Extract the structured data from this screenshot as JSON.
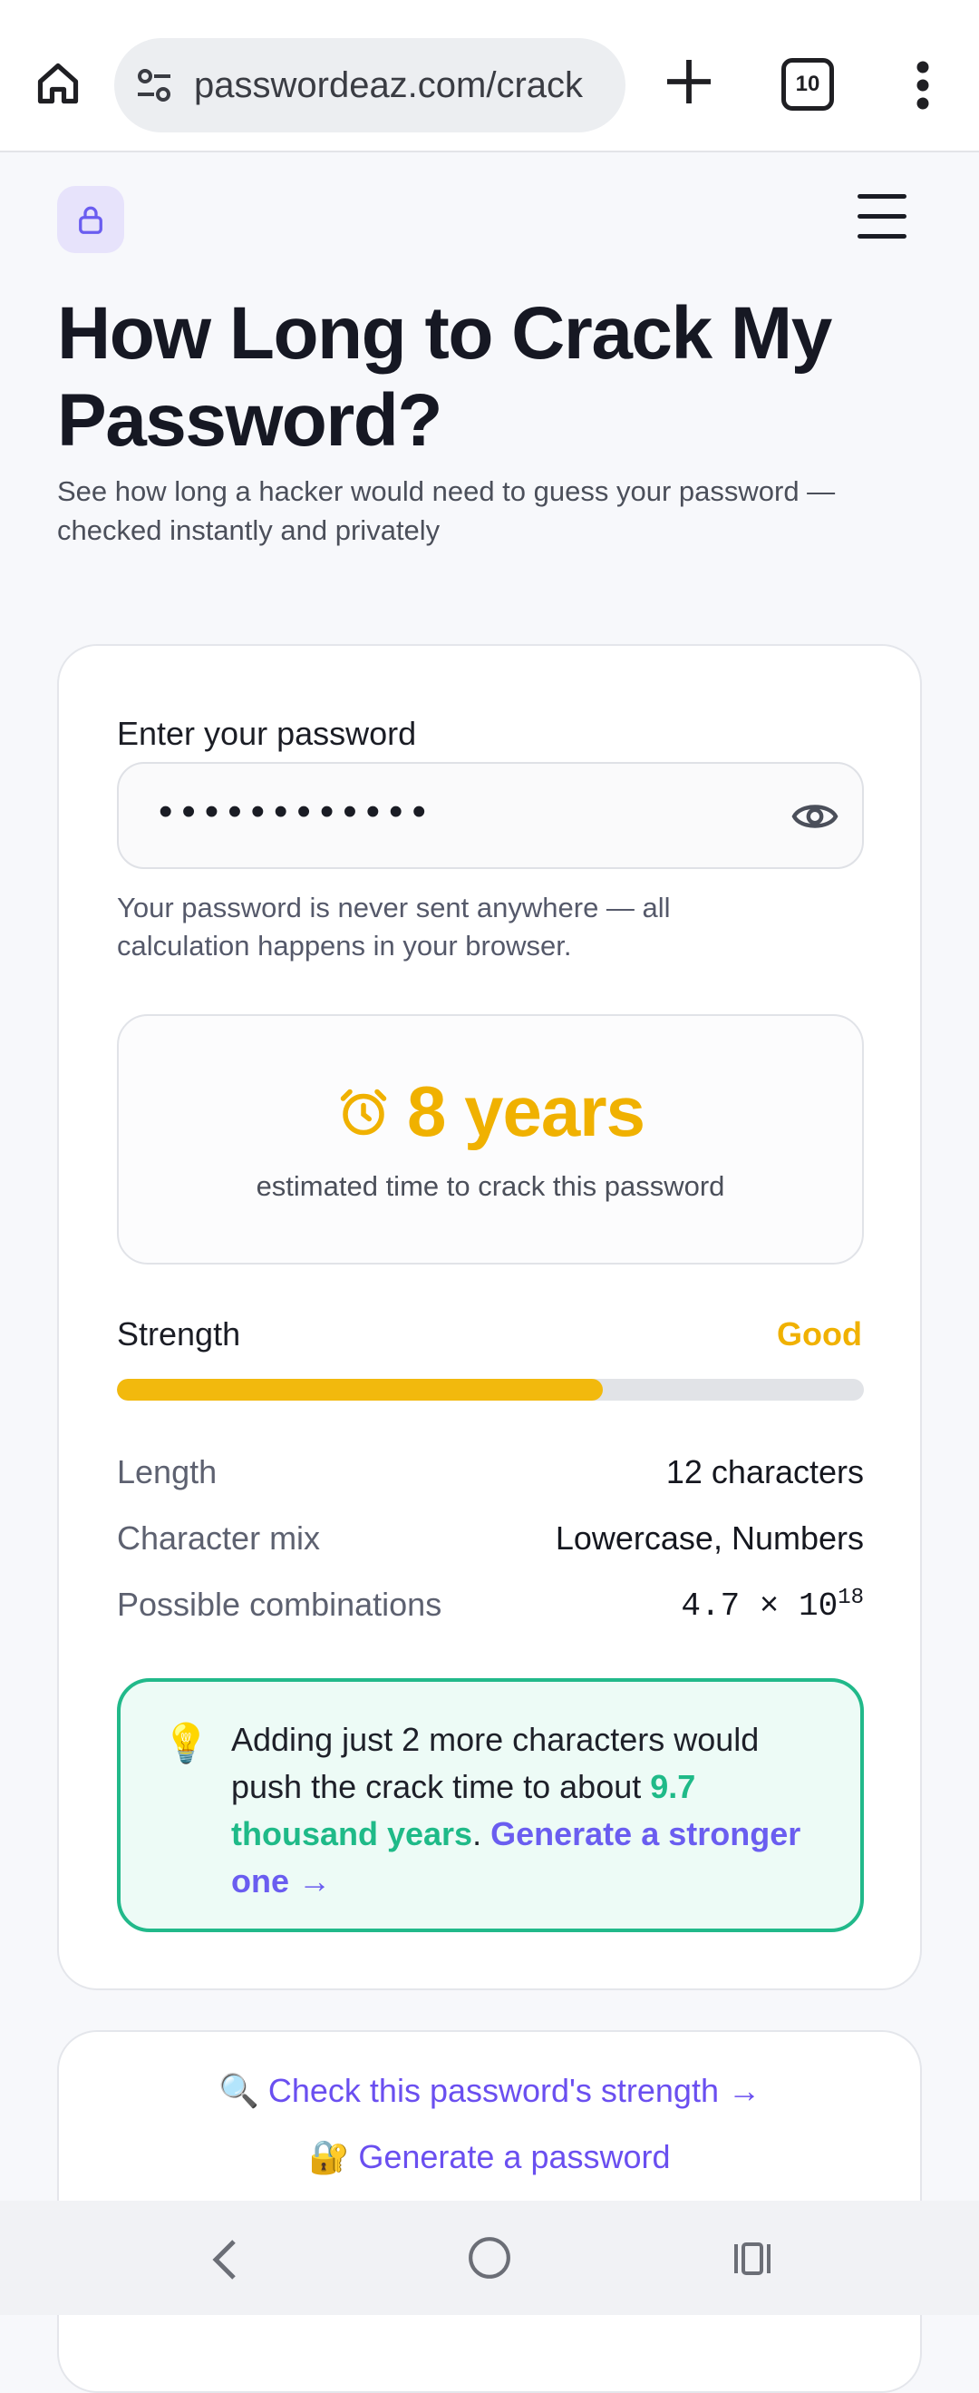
{
  "browser": {
    "url": "passwordeaz.com/crack",
    "tab_count": "10"
  },
  "page": {
    "title": "How Long to Crack My Password?",
    "subtitle": "See how long a hacker would need to guess your password — checked instantly and privately"
  },
  "checker": {
    "input_label": "Enter your password",
    "password_masked": "••••••••••••",
    "privacy_note": "Your password is never sent anywhere — all calculation happens in your browser.",
    "crack_time": "8 years",
    "crack_caption": "estimated time to crack this password",
    "strength_label": "Strength",
    "strength_value": "Good",
    "strength_fraction": 0.65,
    "stats": [
      {
        "key": "Length",
        "value": "12 characters"
      },
      {
        "key": "Character mix",
        "value": "Lowercase, Numbers"
      },
      {
        "key": "Possible combinations",
        "value_base": "4.7 × 10",
        "value_exp": "18"
      }
    ],
    "tip": {
      "icon": "💡",
      "text_before": "Adding just 2 more characters would push the crack time to about ",
      "highlight": "9.7 thousand years",
      "text_after": ". ",
      "link": "Generate a stronger one →"
    }
  },
  "related_links": [
    {
      "icon": "🔍",
      "label": "Check this password's strength →"
    },
    {
      "icon": "🔐",
      "label": "Generate a password"
    }
  ],
  "colors": {
    "accent": "#6a5df0",
    "warning": "#f0b100",
    "success": "#21b98a"
  }
}
